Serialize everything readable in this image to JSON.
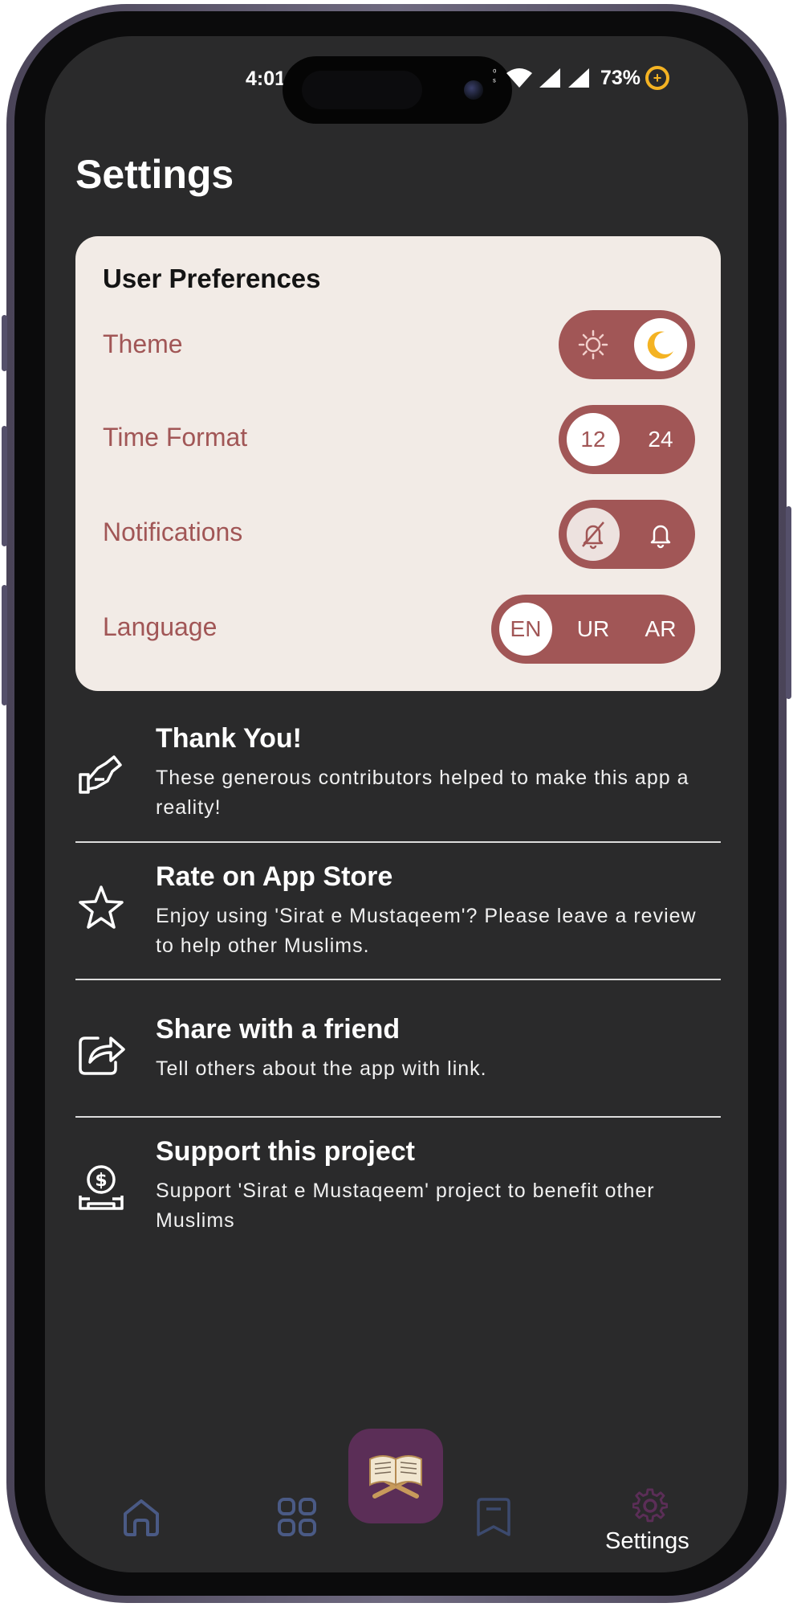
{
  "status_bar": {
    "time": "4:01",
    "battery_percent": "73%",
    "battery_icon": "charging-battery-icon",
    "net_speed_icon": "network-speed-icon",
    "wifi_icon": "wifi-icon",
    "signal_icon": "cellular-signal-icon"
  },
  "page_title": "Settings",
  "preferences": {
    "title": "User Preferences",
    "theme": {
      "label": "Theme",
      "options": [
        "sun-icon",
        "moon-icon"
      ],
      "selected": "moon-icon"
    },
    "time_format": {
      "label": "Time Format",
      "options": [
        "12",
        "24"
      ],
      "selected": "12"
    },
    "notifications": {
      "label": "Notifications",
      "options": [
        "bell-off-icon",
        "bell-icon"
      ],
      "selected": "bell-off-icon"
    },
    "language": {
      "label": "Language",
      "options": [
        "EN",
        "UR",
        "AR"
      ],
      "selected": "EN"
    }
  },
  "list": [
    {
      "icon": "hand-heart-icon",
      "title": "Thank You!",
      "description": "These generous contributors helped to make this app a reality!"
    },
    {
      "icon": "star-icon",
      "title": "Rate on App Store",
      "description": "Enjoy using 'Sirat e Mustaqeem'? Please leave a review to help other Muslims."
    },
    {
      "icon": "share-icon",
      "title": "Share with a friend",
      "description": "Tell others about the app with link."
    },
    {
      "icon": "donate-icon",
      "title": "Support this project",
      "description": "Support 'Sirat e Mustaqeem' project to benefit other Muslims"
    }
  ],
  "bottom_nav": {
    "items": [
      "home-icon",
      "grid-icon",
      "quran-icon",
      "bookmark-icon",
      "settings-icon"
    ],
    "active_label": "Settings",
    "colors": {
      "inactive": "#4a5a85",
      "active": "#5b2e57"
    }
  },
  "colors": {
    "accent": "#a15656",
    "card": "#f2ebe6",
    "background": "#2a2a2b",
    "moon": "#f4b323"
  }
}
